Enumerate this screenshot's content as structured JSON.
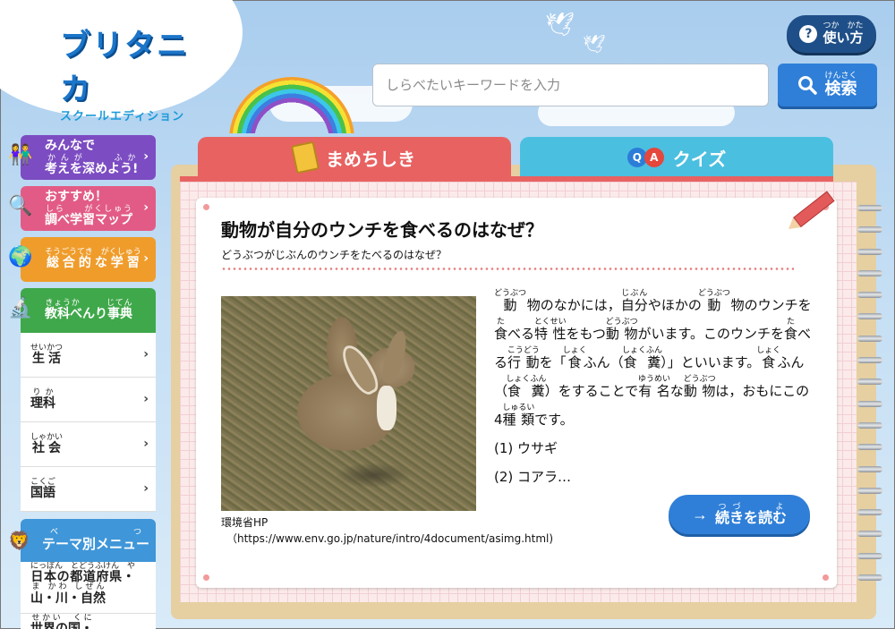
{
  "logo": {
    "main": "ブリタニカ",
    "sub": "スクールエディション"
  },
  "help": {
    "label_rb": "使い方",
    "ruby": "つか　かた"
  },
  "search": {
    "placeholder": "しらべたいキーワードを入力",
    "button_label": "検索",
    "button_ruby": "けんさく"
  },
  "sidebar": {
    "discuss": {
      "line1": "みんなで",
      "line2": "考えを深めよう!",
      "ruby": "かんが　　ふか"
    },
    "recommend": {
      "line1": "おすすめ！",
      "line2": "調べ学習マップ",
      "ruby": "しら　　がくしゅう"
    },
    "integrated": {
      "label": "総合的な学習",
      "ruby": "そうごうてき　がくしゅう"
    },
    "dictionary": {
      "label": "教科べんり事典",
      "ruby": "きょうか　　　じてん"
    },
    "subjects": [
      {
        "label": "生活",
        "ruby": "せいかつ"
      },
      {
        "label": "理科",
        "ruby": "りか"
      },
      {
        "label": "社会",
        "ruby": "しゃかい"
      },
      {
        "label": "国語",
        "ruby": "こくご"
      }
    ],
    "theme": {
      "label": "テーマ別メニュー",
      "ruby": "べつ"
    },
    "theme_items": [
      {
        "label": "日本の都道府県・山・川・自然",
        "ruby": "にっぽん　とどうふけん　やま かわ しぜん"
      },
      {
        "label": "世界の国・",
        "ruby": "せかい　くに"
      }
    ]
  },
  "tabs": {
    "mame": "まめちしき",
    "quiz": "クイズ",
    "qa_q": "Q",
    "qa_a": "A"
  },
  "article": {
    "title": "動物が自分のウンチを食べるのはなぜ？",
    "subtitle": "どうぶつがじぶんのウンチをたべるのはなぜ？",
    "caption_source": "環境省HP",
    "caption_url": "（https://www.env.go.jp/nature/intro/4document/asimg.html)",
    "list_1": "(1) ウサギ",
    "list_2": "(2) コアラ…",
    "read_more": "続きを読む",
    "read_more_ruby": "つづ　　よ"
  }
}
